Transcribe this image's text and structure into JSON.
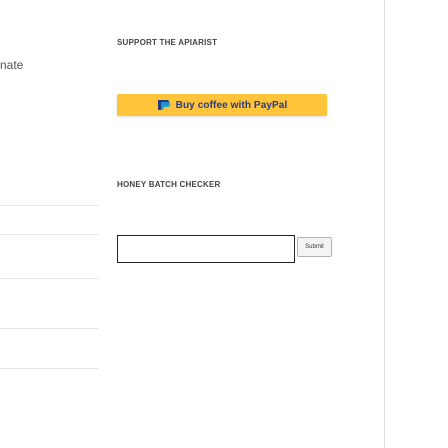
{
  "sidebar": {
    "partial_text": "nate"
  },
  "support": {
    "heading": "SUPPORT THE APIARIST",
    "paypal_button_label": "Buy coffee with PayPal",
    "paypal_button_color": "#ffc439"
  },
  "honey_checker": {
    "heading": "HONEY BATCH CHECKER",
    "input_value": "",
    "submit_label": "Submit"
  }
}
